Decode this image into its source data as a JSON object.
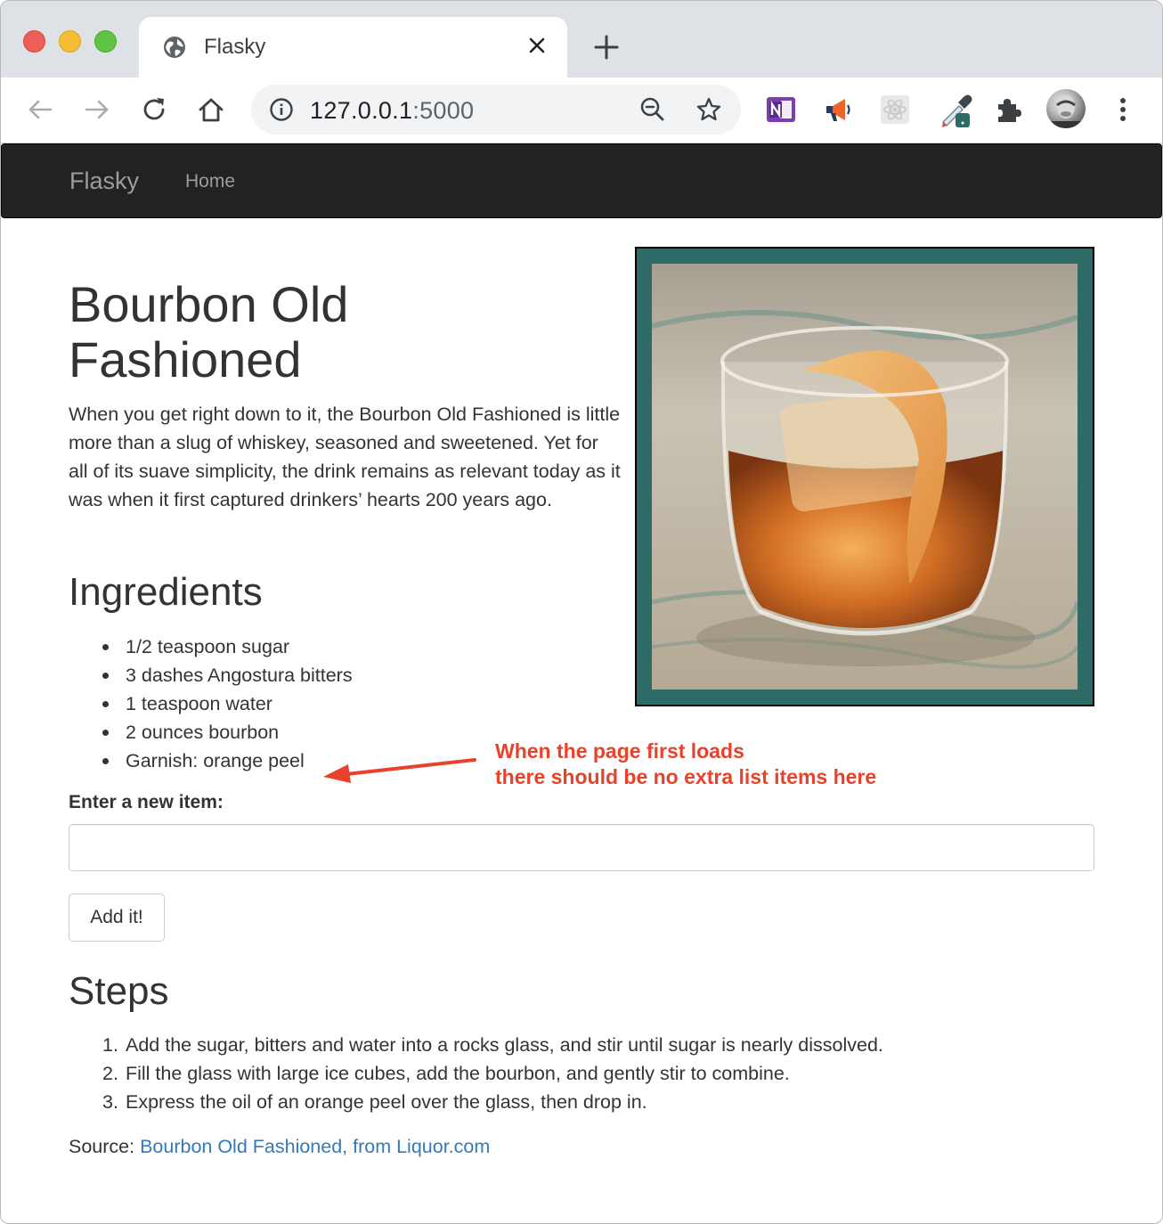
{
  "browser": {
    "tab_title": "Flasky",
    "url_host": "127.0.0.1",
    "url_port": ":5000"
  },
  "navbar": {
    "brand": "Flasky",
    "home_label": "Home"
  },
  "recipe": {
    "title_line1": "Bourbon Old",
    "title_line2": "Fashioned",
    "intro": "When you get right down to it, the Bourbon Old Fashioned is little more than a slug of whiskey, seasoned and sweetened. Yet for all of its suave simplicity, the drink remains as relevant today as it was when it first captured drinkers’ hearts 200 years ago.",
    "ingredients_heading": "Ingredients",
    "ingredients": [
      "1/2 teaspoon sugar",
      "3 dashes Angostura bitters",
      "1 teaspoon water",
      "2 ounces bourbon",
      "Garnish: orange peel"
    ],
    "form": {
      "label": "Enter a new item:",
      "input_value": "",
      "button_label": "Add it!"
    },
    "steps_heading": "Steps",
    "steps": [
      "Add the sugar, bitters and water into a rocks glass, and stir until sugar is nearly dissolved.",
      "Fill the glass with large ice cubes, add the bourbon, and gently stir to combine.",
      "Express the oil of an orange peel over the glass, then drop in."
    ],
    "step_numbers": [
      "1.",
      "2.",
      "3."
    ],
    "source_prefix": "Source: ",
    "source_link": "Bourbon Old Fashioned, from Liquor.com"
  },
  "annotation": {
    "line1": "When the page first loads",
    "line2": "there should be no extra list items here"
  },
  "colors": {
    "navbar_bg": "#222222",
    "link": "#337ab7",
    "annotation": "#e8422b",
    "photo_frame": "#2f6b66"
  }
}
